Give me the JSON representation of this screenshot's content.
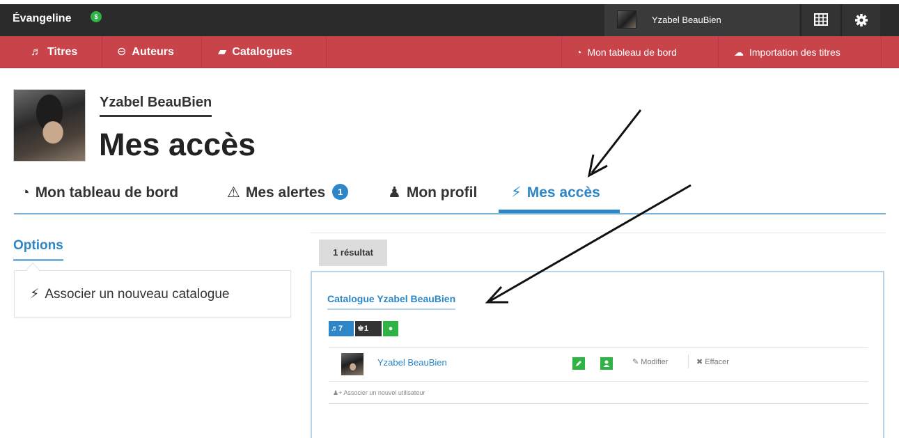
{
  "topbar": {
    "brand": "Évangeline",
    "brand_badge": "$",
    "user_name": "Yzabel BeauBien",
    "grid_icon": "grid-icon",
    "settings_icon": "gear-icon"
  },
  "nav": {
    "titres": "Titres",
    "auteurs": "Auteurs",
    "catalogues": "Catalogues",
    "tableau_de_bord": "Mon tableau de bord",
    "importation": "Importation des titres"
  },
  "profile": {
    "name": "Yzabel BeauBien",
    "page_title": "Mes accès"
  },
  "tabs": {
    "tableau": "Mon tableau de bord",
    "alertes": "Mes alertes",
    "alertes_count": "1",
    "profil": "Mon profil",
    "acces": "Mes accès",
    "active": "acces"
  },
  "options": {
    "title": "Options",
    "associate_catalog": "Associer un nouveau catalogue"
  },
  "results": {
    "count_label": "1 résultat",
    "catalog_name": "Catalogue Yzabel BeauBien",
    "stats": {
      "titles": "7",
      "users": "1"
    },
    "user_row": {
      "name": "Yzabel BeauBien",
      "modify": "Modifier",
      "delete": "Effacer"
    },
    "associate_user": "Associer un nouvel utilisateur"
  },
  "colors": {
    "topbar": "#2b2b2b",
    "navbar": "#c9434a",
    "accent_blue": "#2d86c7",
    "green": "#2fb344"
  }
}
